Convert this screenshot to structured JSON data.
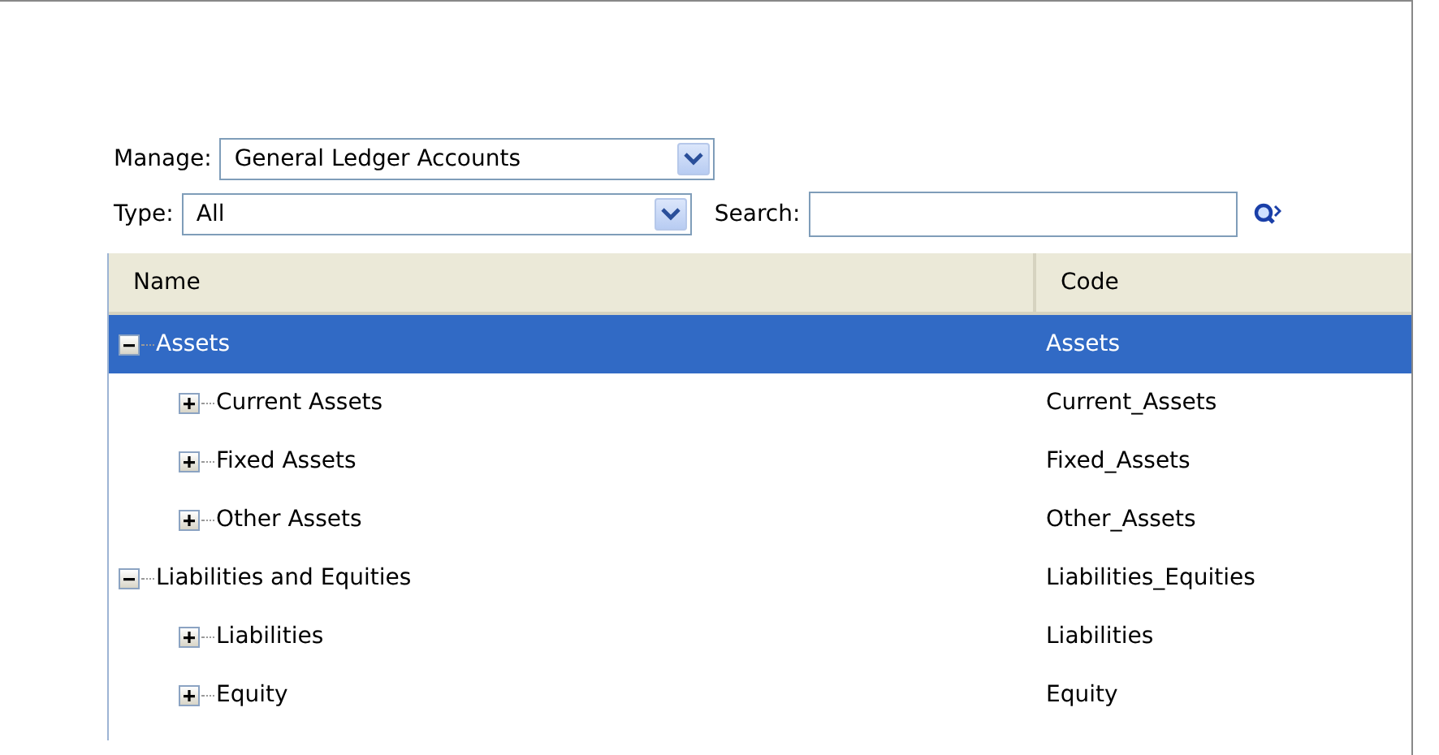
{
  "manage": {
    "label": "Manage:",
    "value": "General Ledger Accounts"
  },
  "type": {
    "label": "Type:",
    "value": "All"
  },
  "search": {
    "label": "Search:"
  },
  "table": {
    "columns": [
      "Name",
      "Code"
    ],
    "rows": [
      {
        "name": "Assets",
        "code": "Assets",
        "expanded": true,
        "selected": true,
        "children": [
          {
            "name": "Current Assets",
            "code": "Current_Assets",
            "expanded": false,
            "selected": false
          },
          {
            "name": "Fixed Assets",
            "code": "Fixed_Assets",
            "expanded": false,
            "selected": false
          },
          {
            "name": "Other Assets",
            "code": "Other_Assets",
            "expanded": false,
            "selected": false
          }
        ]
      },
      {
        "name": "Liabilities and Equities",
        "code": "Liabilities_Equities",
        "expanded": true,
        "selected": false,
        "children": [
          {
            "name": "Liabilities",
            "code": "Liabilities",
            "expanded": false,
            "selected": false
          },
          {
            "name": "Equity",
            "code": "Equity",
            "expanded": false,
            "selected": false
          }
        ]
      }
    ]
  }
}
